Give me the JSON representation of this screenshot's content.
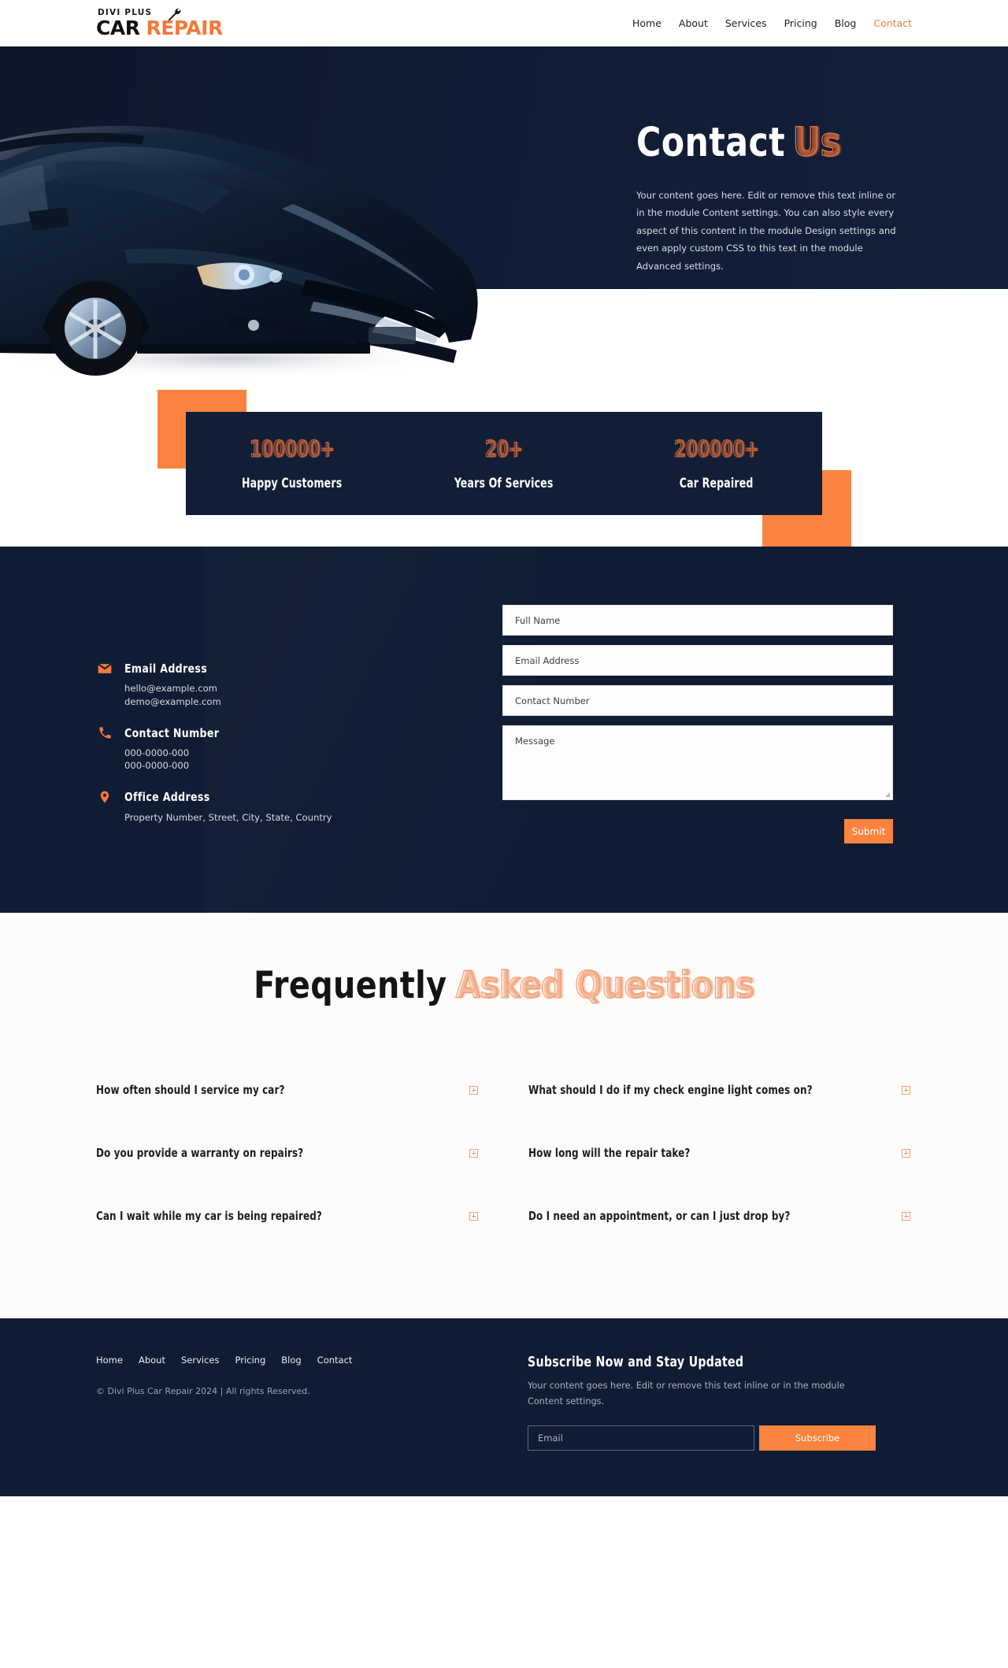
{
  "brand": {
    "tagline": "DIVI PLUS",
    "name_part1": "CAR",
    "name_part2": "REPAIR",
    "wrench_icon": "wrench-icon"
  },
  "nav": {
    "items": [
      {
        "label": "Home",
        "active": false
      },
      {
        "label": "About",
        "active": false
      },
      {
        "label": "Services",
        "active": false
      },
      {
        "label": "Pricing",
        "active": false
      },
      {
        "label": "Blog",
        "active": false
      },
      {
        "label": "Contact",
        "active": true
      }
    ]
  },
  "hero": {
    "title_main": "Contact",
    "title_accent": "Us",
    "paragraph": "Your content goes here. Edit or remove this text inline or in the module Content settings. You can also style every aspect of this content in the module Design settings and even apply custom CSS to this text in the module Advanced settings.",
    "image_alt": "blue-suv-car-image"
  },
  "stats": [
    {
      "number": "100000+",
      "label": "Happy Customers"
    },
    {
      "number": "20+",
      "label": "Years Of Services"
    },
    {
      "number": "200000+",
      "label": "Car Repaired"
    }
  ],
  "contact": {
    "email": {
      "icon": "envelope-icon",
      "title": "Email Address",
      "lines": [
        "hello@example.com",
        "demo@example.com"
      ]
    },
    "phone": {
      "icon": "phone-icon",
      "title": "Contact Number",
      "lines": [
        "000-0000-000",
        "000-0000-000"
      ]
    },
    "address": {
      "icon": "map-pin-icon",
      "title": "Office Address",
      "lines": [
        "Property Number, Street, City, State, Country"
      ]
    },
    "form": {
      "full_name_placeholder": "Full Name",
      "email_placeholder": "Email Address",
      "phone_placeholder": "Contact Number",
      "message_placeholder": "Message",
      "submit_label": "Submit"
    }
  },
  "faq": {
    "title_main": "Frequently",
    "title_accent": "Asked Questions",
    "items_left": [
      "How often should I service my car?",
      "Do you provide a warranty on repairs?",
      "Can I wait while my car is being repaired?"
    ],
    "items_right": [
      "What should I do if my check engine light comes on?",
      "How long will the repair take?",
      "Do I need an appointment, or can I just drop by?"
    ],
    "toggle_icon": "plus-box-icon"
  },
  "footer": {
    "nav": [
      "Home",
      "About",
      "Services",
      "Pricing",
      "Blog",
      "Contact"
    ],
    "copyright": "© Divi Plus Car Repair 2024 | All rights Reserved.",
    "subscribe_title": "Subscribe Now and Stay Updated",
    "subscribe_para": "Your content goes here. Edit or remove this text inline or in the module Content settings.",
    "email_placeholder": "Email",
    "subscribe_label": "Subscribe"
  },
  "colors": {
    "accent": "#F9833F",
    "accent_outline": "#E8703A",
    "dark": "#101C33",
    "dark_box": "#121E36",
    "faq_outline": "#F0996B"
  }
}
